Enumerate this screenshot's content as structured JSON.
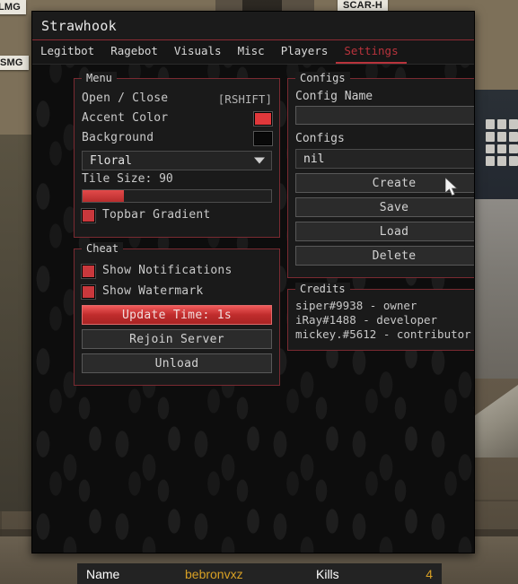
{
  "window": {
    "title": "Strawhook",
    "tabs": [
      {
        "label": "Legitbot",
        "active": false
      },
      {
        "label": "Ragebot",
        "active": false
      },
      {
        "label": "Visuals",
        "active": false
      },
      {
        "label": "Misc",
        "active": false
      },
      {
        "label": "Players",
        "active": false
      },
      {
        "label": "Settings",
        "active": true
      }
    ]
  },
  "menu_group": {
    "title": "Menu",
    "open_close_label": "Open / Close",
    "open_close_key": "[RSHIFT]",
    "accent_color_label": "Accent Color",
    "accent_color_value": "#e0383b",
    "background_label": "Background",
    "background_value": "#090909",
    "theme_selected": "Floral",
    "tile_size_label": "Tile Size: 90",
    "tile_size_value": 90,
    "tile_size_percent": 22,
    "topbar_gradient_label": "Topbar Gradient",
    "topbar_gradient_checked": true
  },
  "cheat_group": {
    "title": "Cheat",
    "show_notifications_label": "Show Notifications",
    "show_notifications_checked": true,
    "show_watermark_label": "Show Watermark",
    "show_watermark_checked": true,
    "update_time_label": "Update Time: 1s",
    "rejoin_label": "Rejoin Server",
    "unload_label": "Unload"
  },
  "configs_group": {
    "title": "Configs",
    "config_name_label": "Config Name",
    "config_name_value": "",
    "config_name_placeholder": "",
    "configs_label": "Configs",
    "configs_selected": "nil",
    "create_label": "Create",
    "save_label": "Save",
    "load_label": "Load",
    "delete_label": "Delete"
  },
  "credits_group": {
    "title": "Credits",
    "lines": [
      "siper#9938 - owner",
      "iRay#1488 - developer",
      "mickey.#5612 - contributor"
    ]
  },
  "game": {
    "weapon_labels": {
      "left_top": "LMG",
      "left_bottom": "SMG",
      "right_top": "SCAR-H"
    },
    "scoreboard": {
      "name_header": "Name",
      "name_value": "bebronvxz",
      "kills_header": "Kills",
      "kills_value": "4"
    }
  }
}
